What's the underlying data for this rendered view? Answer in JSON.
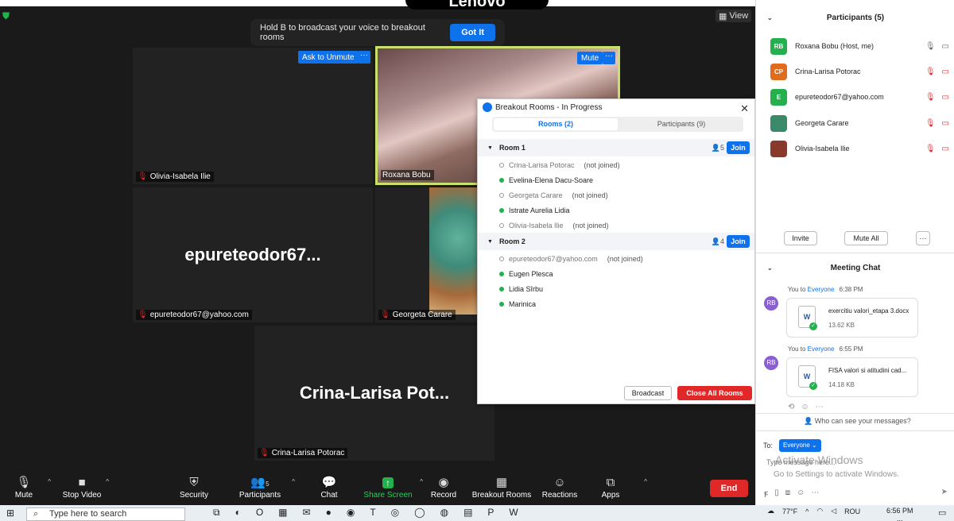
{
  "banner": {
    "text": "Hold B to broadcast your voice to breakout rooms",
    "button": "Got It"
  },
  "top": {
    "brand": "Lenovo",
    "view": "View"
  },
  "tiles": {
    "olivia": {
      "name": "Olivia-Isabela Ilie",
      "button": "Ask to Unmute"
    },
    "roxana": {
      "name": "Roxana Bobu",
      "button": "Mute"
    },
    "epure": {
      "name": "epureteodor67@yahoo.com",
      "big": "epureteodor67..."
    },
    "georgeta": {
      "name": "Georgeta Carare"
    },
    "crina": {
      "name": "Crina-Larisa Potorac",
      "big": "Crina-Larisa  Pot..."
    },
    "more": "···"
  },
  "toolbar": {
    "mute": "Mute",
    "stop_video": "Stop Video",
    "security": "Security",
    "participants": "Participants",
    "participants_count": "5",
    "chat": "Chat",
    "share": "Share Screen",
    "record": "Record",
    "breakout": "Breakout Rooms",
    "reactions": "Reactions",
    "apps": "Apps",
    "end": "End"
  },
  "breakout": {
    "title": "Breakout Rooms - In Progress",
    "tab_rooms": "Rooms (2)",
    "tab_participants": "Participants (9)",
    "join": "Join",
    "rooms": [
      {
        "name": "Room 1",
        "count": "5",
        "members": [
          {
            "name": "Crina-Larisa Potorac",
            "status": "(not joined)",
            "joined": false
          },
          {
            "name": "Evelina-Elena Dacu-Soare",
            "status": "",
            "joined": true
          },
          {
            "name": "Georgeta Carare",
            "status": "(not joined)",
            "joined": false
          },
          {
            "name": "Istrate Aurelia Lidia",
            "status": "",
            "joined": true
          },
          {
            "name": "Olivia-Isabela Ilie",
            "status": "(not joined)",
            "joined": false
          }
        ]
      },
      {
        "name": "Room 2",
        "count": "4",
        "members": [
          {
            "name": "epureteodor67@yahoo.com",
            "status": "(not joined)",
            "joined": false
          },
          {
            "name": "Eugen Plesca",
            "status": "",
            "joined": true
          },
          {
            "name": "Lidia Sîrbu",
            "status": "",
            "joined": true
          },
          {
            "name": "Marinica",
            "status": "",
            "joined": true
          }
        ]
      }
    ],
    "broadcast": "Broadcast",
    "close_all": "Close All Rooms"
  },
  "participants": {
    "title": "Participants (5)",
    "list": [
      {
        "initials": "RB",
        "name": "Roxana Bobu (Host, me)",
        "color": "#23b04d"
      },
      {
        "initials": "CP",
        "name": "Crina-Larisa Potorac",
        "color": "#e06c1c"
      },
      {
        "initials": "E",
        "name": "epureteodor67@yahoo.com",
        "color": "#23b04d"
      },
      {
        "initials": "",
        "name": "Georgeta Carare",
        "color": "#3a8a6a"
      },
      {
        "initials": "",
        "name": "Olivia-Isabela Ilie",
        "color": "#8a3a2a"
      }
    ],
    "invite": "Invite",
    "mute_all": "Mute All",
    "more": "···"
  },
  "chat": {
    "title": "Meeting Chat",
    "messages": [
      {
        "avatar": "RB",
        "from": "You to ",
        "to": "Everyone",
        "time": "6:38 PM",
        "file": "exercitiu valori_etapa 3.docx",
        "size": "13.62 KB"
      },
      {
        "avatar": "RB",
        "from": "You to ",
        "to": "Everyone",
        "time": "6:55 PM",
        "file": "FISA  valori si atitudini cad...",
        "size": "14.18 KB"
      }
    ],
    "who_can_see": "Who can see your messages?",
    "to_label": "To:",
    "to_value": "Everyone",
    "placeholder": "Type message here...",
    "activate_title": "Activate Windows",
    "activate_sub": "Go to Settings to activate Windows."
  },
  "taskbar": {
    "search": "Type here to search",
    "weather": "77°F",
    "lang": "ROU",
    "time": "6:56 PM",
    "date": "..."
  }
}
